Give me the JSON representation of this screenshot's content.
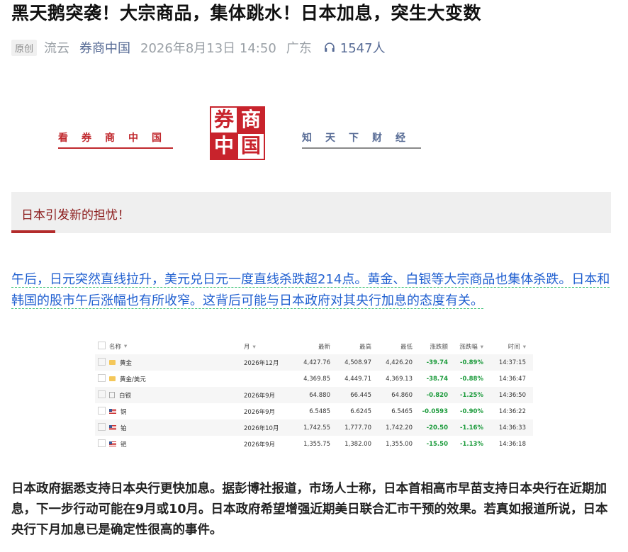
{
  "article": {
    "title": "黑天鹅突袭！大宗商品，集体跳水！日本加息，突生大变数",
    "badge": "原创",
    "author": "流云",
    "account": "券商中国",
    "date": "2026年8月13日 14:50",
    "region": "广东",
    "listeners": "1547人"
  },
  "brand": {
    "left_text": "看券商中国",
    "logo_chars": [
      "券",
      "商",
      "中",
      "国"
    ],
    "right_text": "知天下财经"
  },
  "section": {
    "title": "日本引发新的担忧！"
  },
  "blue_paragraph": "午后，日元突然直线拉升，美元兑日元一度直线杀跌超214点。黄金、白银等大宗商品也集体杀跌。日本和韩国的股市午后涨幅也有所收窄。这背后可能与日本政府对其央行加息的态度有关。",
  "table": {
    "headers": [
      "名称",
      "月",
      "最新",
      "最高",
      "最低",
      "涨跌额",
      "涨跌幅",
      "时间"
    ],
    "rows": [
      {
        "icon": "folder",
        "name": "黄金",
        "month": "2026年12月",
        "last": "4,427.76",
        "high": "4,508.97",
        "low": "4,426.20",
        "chg": "-39.74",
        "pct": "-0.89%",
        "time": "14:37:15"
      },
      {
        "icon": "folder",
        "name": "黄金/美元",
        "month": "",
        "last": "4,369.85",
        "high": "4,449.71",
        "low": "4,369.13",
        "chg": "-38.74",
        "pct": "-0.88%",
        "time": "14:36:47"
      },
      {
        "icon": "file",
        "name": "白银",
        "month": "2026年9月",
        "last": "64.880",
        "high": "66.445",
        "low": "64.860",
        "chg": "-0.820",
        "pct": "-1.25%",
        "time": "14:36:50"
      },
      {
        "icon": "flag",
        "name": "铜",
        "month": "2026年9月",
        "last": "6.5485",
        "high": "6.6245",
        "low": "6.5465",
        "chg": "-0.0593",
        "pct": "-0.90%",
        "time": "14:36:22"
      },
      {
        "icon": "flag",
        "name": "铂",
        "month": "2026年10月",
        "last": "1,742.55",
        "high": "1,777.70",
        "low": "1,742.20",
        "chg": "-20.50",
        "pct": "-1.16%",
        "time": "14:36:33"
      },
      {
        "icon": "flag",
        "name": "钯",
        "month": "2026年9月",
        "last": "1,355.75",
        "high": "1,382.00",
        "low": "1,355.00",
        "chg": "-15.50",
        "pct": "-1.13%",
        "time": "14:36:18"
      }
    ]
  },
  "bottom_paragraph": "日本政府据悉支持日本央行更快加息。据彭博社报道，市场人士称，日本首相高市早苗支持日本央行在近期加息，下一步行动可能在9月或10月。日本政府希望增强近期美日联合汇市干预的效果。若真如报道所说，日本央行下月加息已是确定性很高的事件。",
  "colors": {
    "accent_red": "#c8232c",
    "link_blue": "#576b95",
    "body_blue": "#1f5fd0",
    "down_green": "#1a9a3a"
  }
}
